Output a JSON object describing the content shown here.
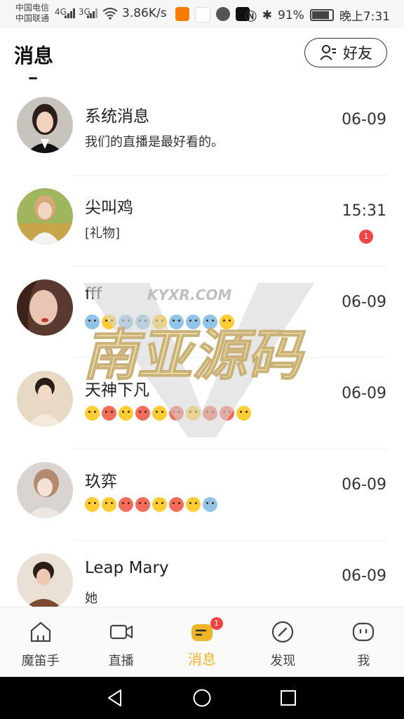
{
  "status_bar": {
    "carrier1": "中国电信",
    "carrier2": "中国联通",
    "sig1": "4G",
    "sig2": "3G",
    "speed": "3.86K/s",
    "battery": "91%",
    "time": "晚上7:31"
  },
  "header": {
    "title": "消息",
    "friends_label": "好友"
  },
  "conversations": [
    {
      "name": "系统消息",
      "preview": "我们的直播是最好看的。",
      "time": "06-09",
      "badge": ""
    },
    {
      "name": "尖叫鸡",
      "preview": "[礼物]",
      "time": "15:31",
      "badge": "1"
    },
    {
      "name": "fff",
      "preview": "",
      "time": "06-09",
      "badge": ""
    },
    {
      "name": "天神下凡",
      "preview": "",
      "time": "06-09",
      "badge": ""
    },
    {
      "name": "玖弈",
      "preview": "",
      "time": "06-09",
      "badge": ""
    },
    {
      "name": "Leap Mary",
      "preview": "她",
      "time": "06-09",
      "badge": ""
    }
  ],
  "watermark": {
    "line1": "KYXR.COM",
    "line2": "南亚源码"
  },
  "bottom_nav": {
    "items": [
      {
        "label": "魔笛手",
        "icon": "home-icon"
      },
      {
        "label": "直播",
        "icon": "video-camera-icon"
      },
      {
        "label": "消息",
        "icon": "message-icon",
        "badge": "1"
      },
      {
        "label": "发现",
        "icon": "compass-icon"
      },
      {
        "label": "我",
        "icon": "profile-face-icon"
      }
    ]
  },
  "colors": {
    "accent": "#f0b429",
    "badge": "#f04545"
  }
}
